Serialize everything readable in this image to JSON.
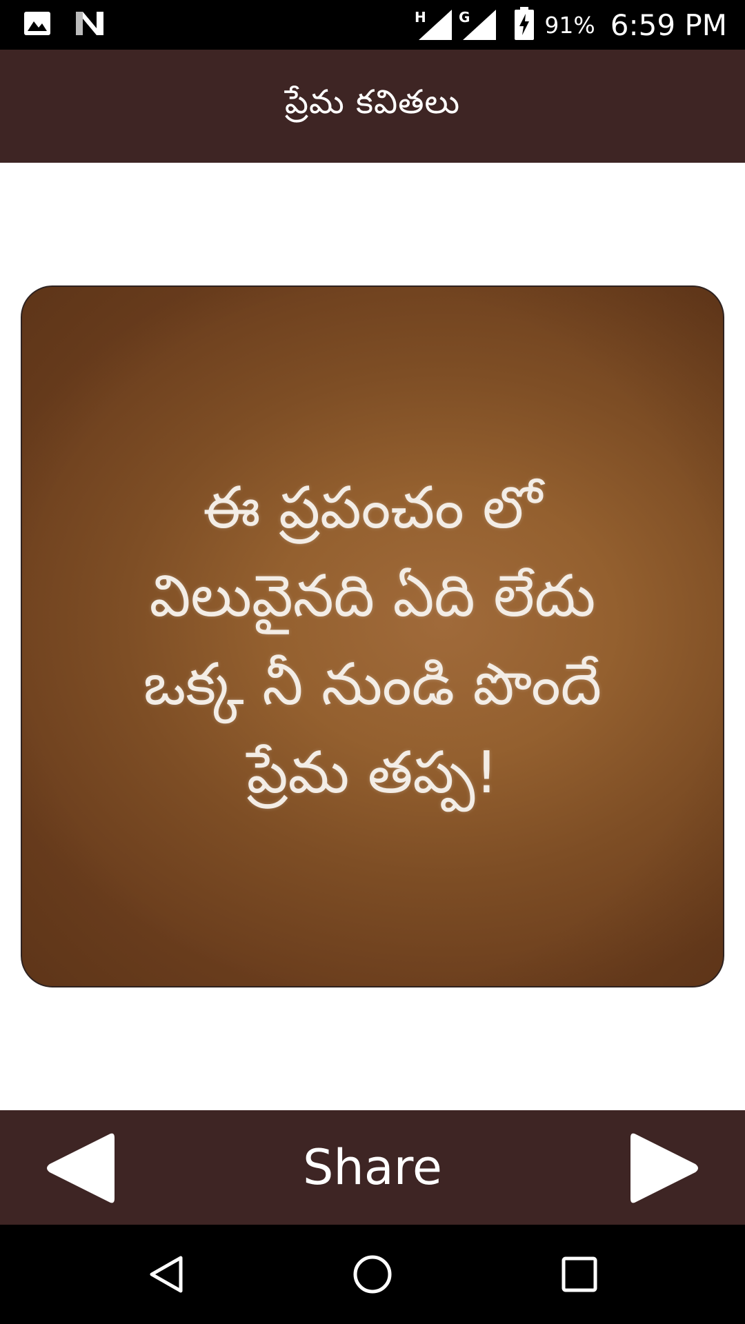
{
  "status_bar": {
    "left_icons": [
      "image-icon",
      "n-app-icon"
    ],
    "network_h": "H",
    "network_g": "G",
    "battery_percent": "91%",
    "time": "6:59 PM"
  },
  "toolbar": {
    "title": "ప్రేమ కవితలు"
  },
  "quote": {
    "lines": [
      "ఈ ప్రపంచం లో",
      "విలువైనది ఏది లేదు",
      "ఒక్క నీ నుండి పొందే",
      "ప్రేమ తప్ప!"
    ]
  },
  "actions": {
    "prev_icon": "triangle-left-icon",
    "share_label": "Share",
    "next_icon": "triangle-right-icon"
  },
  "nav": {
    "icons": [
      "back-icon",
      "home-icon",
      "recents-icon"
    ]
  },
  "colors": {
    "primary_dark": "#3e2524",
    "card_brown": "#94602f"
  }
}
